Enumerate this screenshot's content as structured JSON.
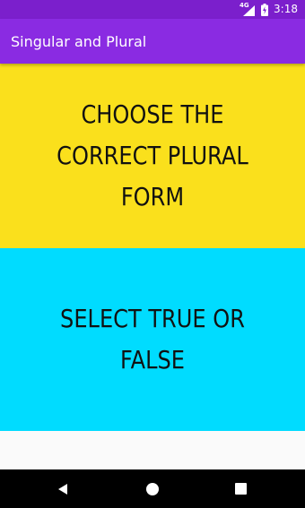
{
  "status_bar": {
    "network": "4G",
    "time": "3:18"
  },
  "app_bar": {
    "title": "Singular and Plural"
  },
  "cards": [
    {
      "label": "CHOOSE THE CORRECT PLURAL FORM",
      "color": "#fae01c"
    },
    {
      "label": "SELECT TRUE OR FALSE",
      "color": "#00dcff"
    }
  ],
  "nav_bar": {
    "icons": [
      "back-icon",
      "home-icon",
      "recent-apps-icon"
    ]
  }
}
